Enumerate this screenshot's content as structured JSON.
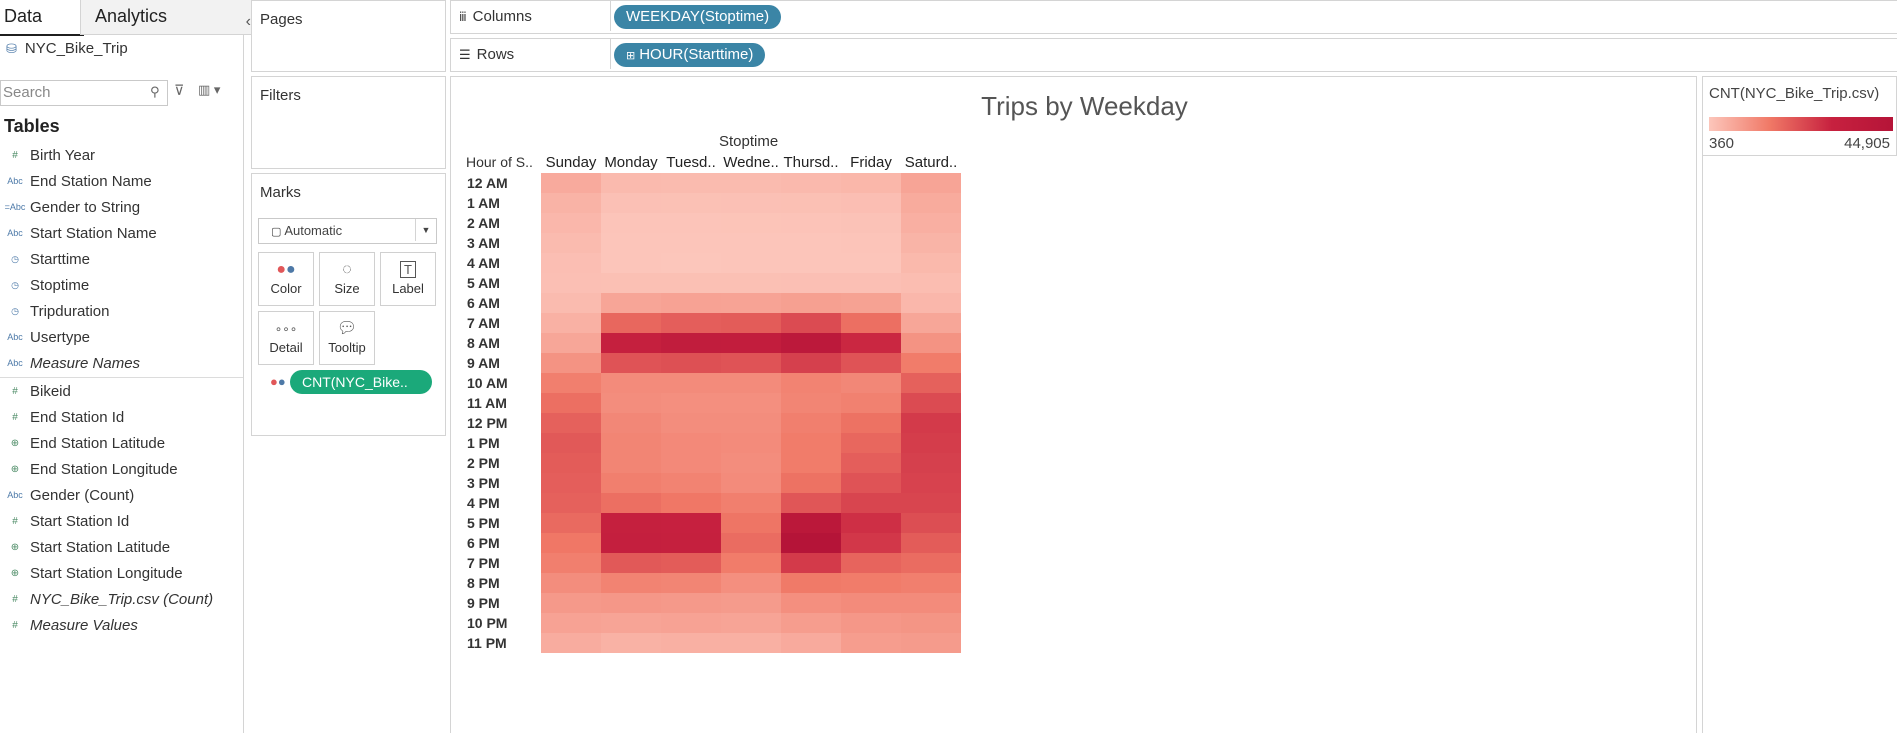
{
  "left_pane": {
    "tabs": {
      "data": "Data",
      "analytics": "Analytics"
    },
    "collapse_icon": "chevron-left",
    "datasource": "NYC_Bike_Trip",
    "search_placeholder": "Search",
    "tables_heading": "Tables",
    "dimensions": [
      {
        "type": "number",
        "label": "Birth Year",
        "italic": false
      },
      {
        "type": "string",
        "label": "End Station Name",
        "italic": false
      },
      {
        "type": "string-calc",
        "label": "Gender to String",
        "italic": false
      },
      {
        "type": "string",
        "label": "Start Station Name",
        "italic": false
      },
      {
        "type": "datetime",
        "label": "Starttime",
        "italic": false
      },
      {
        "type": "datetime",
        "label": "Stoptime",
        "italic": false
      },
      {
        "type": "datetime",
        "label": "Tripduration",
        "italic": false
      },
      {
        "type": "string",
        "label": "Usertype",
        "italic": false
      },
      {
        "type": "string",
        "label": "Measure Names",
        "italic": true
      }
    ],
    "measures": [
      {
        "type": "number",
        "label": "Bikeid",
        "italic": false
      },
      {
        "type": "number",
        "label": "End Station Id",
        "italic": false
      },
      {
        "type": "geo",
        "label": "End Station Latitude",
        "italic": false
      },
      {
        "type": "geo",
        "label": "End Station Longitude",
        "italic": false
      },
      {
        "type": "string",
        "label": "Gender (Count)",
        "italic": false
      },
      {
        "type": "number",
        "label": "Start Station Id",
        "italic": false
      },
      {
        "type": "geo",
        "label": "Start Station Latitude",
        "italic": false
      },
      {
        "type": "geo",
        "label": "Start Station Longitude",
        "italic": false
      },
      {
        "type": "number",
        "label": "NYC_Bike_Trip.csv (Count)",
        "italic": true
      },
      {
        "type": "number",
        "label": "Measure Values",
        "italic": true
      }
    ]
  },
  "cards": {
    "pages": "Pages",
    "filters": "Filters",
    "marks": "Marks",
    "mark_type": "Automatic",
    "mark_buttons": [
      "Color",
      "Size",
      "Label",
      "Detail",
      "Tooltip"
    ],
    "color_pill": "CNT(NYC_Bike.."
  },
  "shelves": {
    "columns_label": "Columns",
    "columns_pill": "WEEKDAY(Stoptime)",
    "rows_label": "Rows",
    "rows_pill": "HOUR(Starttime)"
  },
  "legend": {
    "title": "CNT(NYC_Bike_Trip.csv)",
    "min": "360",
    "max": "44,905",
    "color_low": "#fcc6bb",
    "color_high": "#b51438"
  },
  "chart_data": {
    "type": "heatmap",
    "title": "Trips by Weekday",
    "column_field": "Stoptime",
    "row_field": "Hour of S..",
    "columns": [
      "Sunday",
      "Monday",
      "Tuesd..",
      "Wedne..",
      "Thursd..",
      "Friday",
      "Saturd.."
    ],
    "rows": [
      "12 AM",
      "1 AM",
      "2 AM",
      "3 AM",
      "4 AM",
      "5 AM",
      "6 AM",
      "7 AM",
      "8 AM",
      "9 AM",
      "10 AM",
      "11 AM",
      "12 PM",
      "1 PM",
      "2 PM",
      "3 PM",
      "4 PM",
      "5 PM",
      "6 PM",
      "7 PM",
      "8 PM",
      "9 PM",
      "10 PM",
      "11 PM"
    ],
    "value_range": [
      360,
      44905
    ],
    "values": [
      [
        7500,
        3400,
        3300,
        3300,
        3600,
        4300,
        9000
      ],
      [
        5300,
        1800,
        1700,
        1800,
        1900,
        2300,
        7400
      ],
      [
        4200,
        900,
        900,
        1000,
        1100,
        1400,
        6200
      ],
      [
        3200,
        600,
        500,
        600,
        700,
        900,
        5000
      ],
      [
        2300,
        500,
        400,
        500,
        500,
        700,
        3800
      ],
      [
        2100,
        1900,
        2000,
        1900,
        2100,
        2100,
        2700
      ],
      [
        3200,
        8800,
        9500,
        9300,
        10200,
        9700,
        4200
      ],
      [
        5800,
        23500,
        25000,
        25500,
        28500,
        22000,
        8500
      ],
      [
        8700,
        37000,
        39000,
        38500,
        41500,
        35000,
        13500
      ],
      [
        13500,
        27000,
        27500,
        27000,
        30500,
        27000,
        19500
      ],
      [
        18500,
        15500,
        15500,
        15500,
        17500,
        16500,
        24500
      ],
      [
        22000,
        15000,
        14500,
        14500,
        17000,
        18000,
        28500
      ],
      [
        24500,
        16500,
        15000,
        15000,
        18500,
        21500,
        31500
      ],
      [
        26000,
        17000,
        16000,
        15500,
        19500,
        23500,
        31000
      ],
      [
        25500,
        17000,
        16000,
        15000,
        19500,
        25000,
        30500
      ],
      [
        25000,
        18500,
        17500,
        15500,
        21500,
        27000,
        30000
      ],
      [
        24500,
        22000,
        20500,
        18500,
        26500,
        29500,
        29500
      ],
      [
        23000,
        37000,
        36500,
        21000,
        42000,
        33500,
        28000
      ],
      [
        20500,
        37500,
        37000,
        22500,
        44905,
        32000,
        25500
      ],
      [
        18500,
        26000,
        25500,
        19500,
        31500,
        24000,
        22500
      ],
      [
        15000,
        17500,
        17000,
        14500,
        20000,
        19500,
        18500
      ],
      [
        12000,
        12500,
        12000,
        11500,
        14500,
        15500,
        15500
      ],
      [
        9500,
        9000,
        9500,
        9000,
        11000,
        12500,
        13000
      ],
      [
        7000,
        5500,
        6000,
        6000,
        7500,
        11000,
        11500
      ]
    ]
  }
}
